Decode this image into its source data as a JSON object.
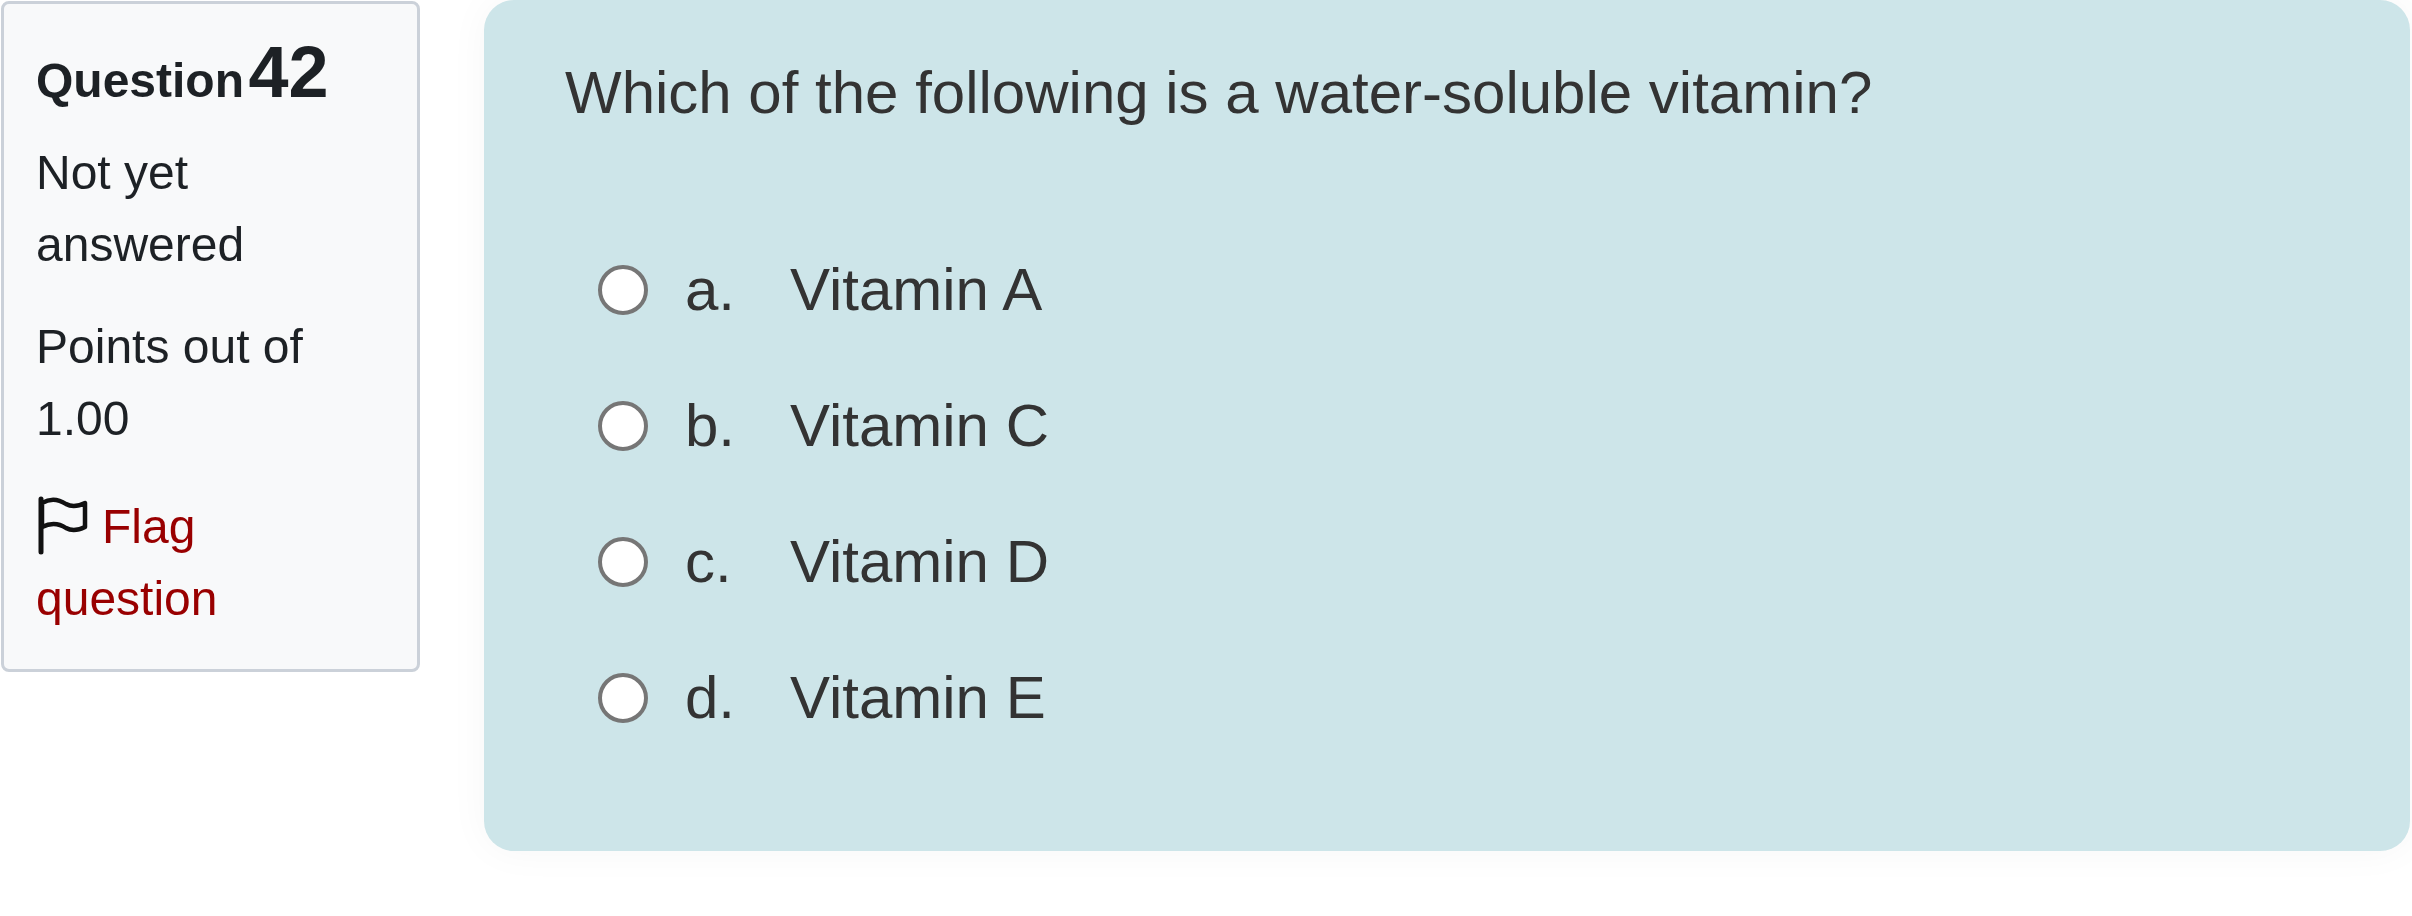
{
  "question_info": {
    "label": "Question",
    "number": "42",
    "status": "Not yet answered",
    "grade": "Points out of 1.00",
    "flag_link": {
      "label": "Flag question",
      "flagged": false
    }
  },
  "formulation": {
    "question_text": "Which of the following is a water-soluble vitamin?",
    "options": [
      {
        "letter": "a.",
        "text": "Vitamin A",
        "selected": false
      },
      {
        "letter": "b.",
        "text": "Vitamin C",
        "selected": false
      },
      {
        "letter": "c.",
        "text": "Vitamin D",
        "selected": false
      },
      {
        "letter": "d.",
        "text": "Vitamin E",
        "selected": false
      }
    ]
  }
}
